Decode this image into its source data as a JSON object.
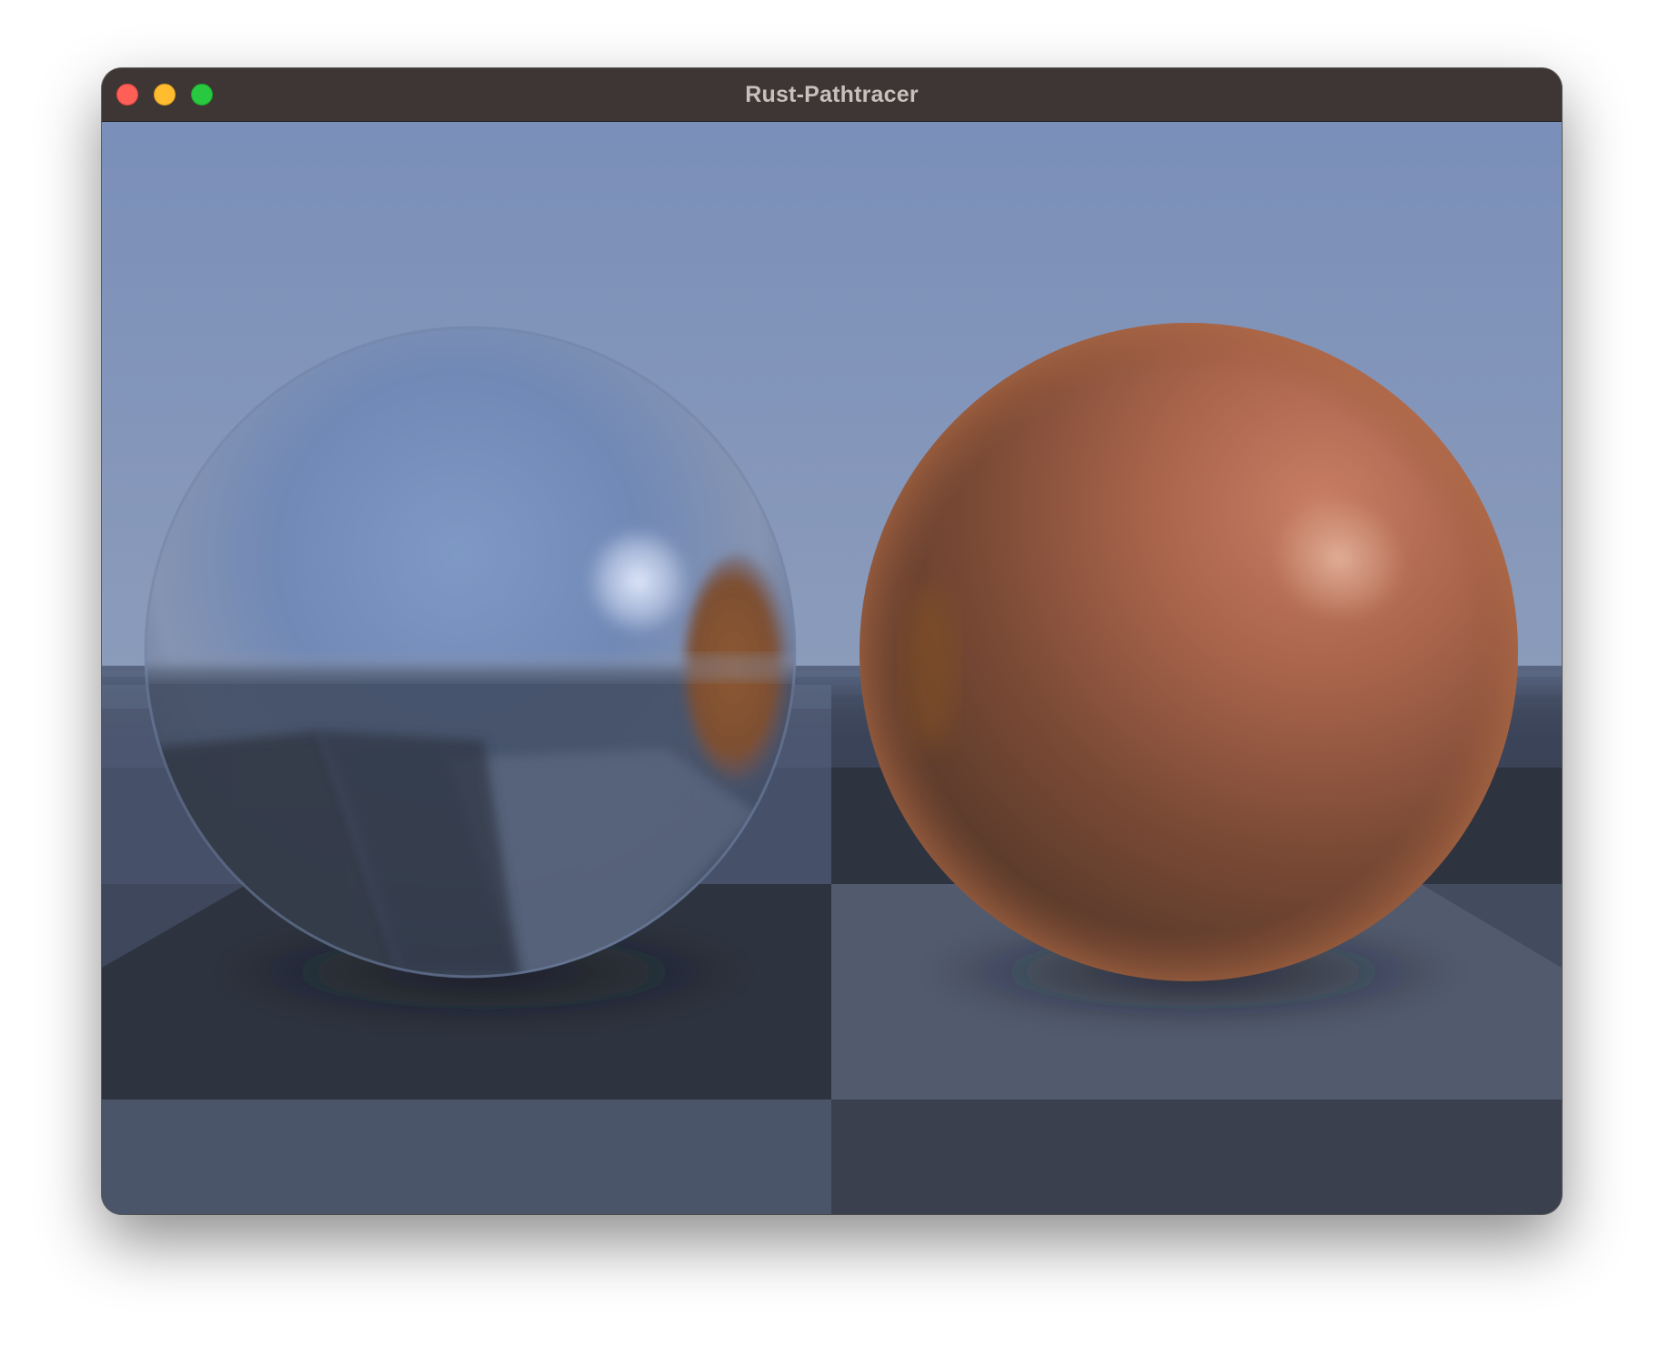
{
  "window": {
    "title": "Rust-Pathtracer",
    "controls": {
      "close_icon": "close-icon",
      "minimize_icon": "minimize-icon",
      "zoom_icon": "zoom-icon"
    }
  },
  "scene": {
    "colors": {
      "sky_top": "#7a8fb9",
      "sky_horizon": "#8a9ab8",
      "floor_dark": "#2b303c",
      "floor_light": "#4a556b",
      "chrome_sphere": "#6f86b4",
      "copper_sphere": "#b5654a"
    }
  }
}
